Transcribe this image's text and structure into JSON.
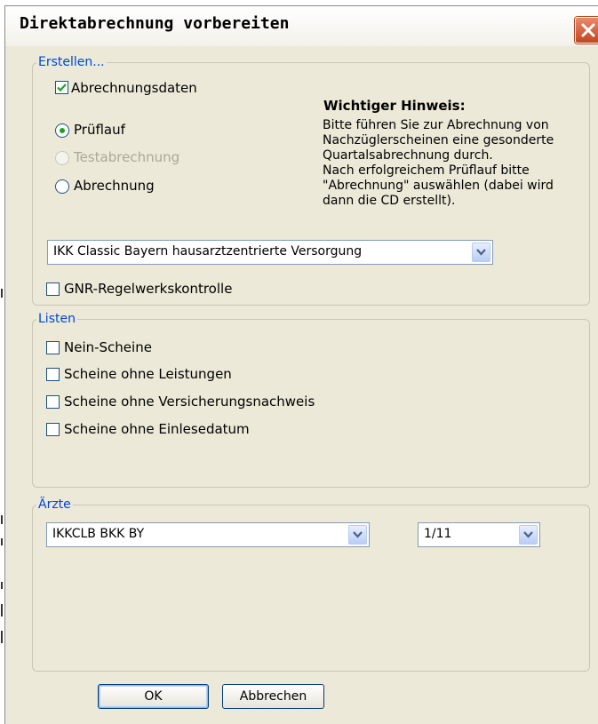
{
  "window": {
    "title": "Direktabrechnung vorbereiten",
    "close_icon": "close-x-icon"
  },
  "erstellen": {
    "legend": "Erstellen...",
    "abrechnungsdaten": {
      "label": "Abrechnungsdaten",
      "checked": true
    },
    "radios": [
      {
        "label": "Prüflauf",
        "selected": true,
        "disabled": false
      },
      {
        "label": "Testabrechnung",
        "selected": false,
        "disabled": true
      },
      {
        "label": "Abrechnung",
        "selected": false,
        "disabled": false
      }
    ],
    "hint_title": "Wichtiger Hinweis:",
    "hint_text": "Bitte führen Sie zur Abrechnung von\nNachzüglerscheinen eine gesonderte\nQuartalsabrechnung durch.\nNach erfolgreichem Prüflauf bitte\n\"Abrechnung\" auswählen (dabei wird\ndann die CD erstellt).",
    "kasse_select": "IKK Classic Bayern hausarztzentrierte Versorgung",
    "gnr": {
      "label": "GNR-Regelwerkskontrolle",
      "checked": false
    }
  },
  "listen": {
    "legend": "Listen",
    "items": [
      {
        "label": "Nein-Scheine",
        "checked": false
      },
      {
        "label": "Scheine ohne Leistungen",
        "checked": false
      },
      {
        "label": "Scheine ohne Versicherungsnachweis",
        "checked": false
      },
      {
        "label": "Scheine ohne Einlesedatum",
        "checked": false
      }
    ]
  },
  "aerzte": {
    "legend": "Ärzte",
    "arzt_select": "IKKCLB BKK BY",
    "quartal_select": "1/11"
  },
  "buttons": {
    "ok": "OK",
    "cancel": "Abbrechen"
  },
  "colors": {
    "legend": "#0046d5",
    "radio_dot": "#21a121",
    "close_button": "#c24520",
    "dialog_bg": "#ece9d8"
  }
}
